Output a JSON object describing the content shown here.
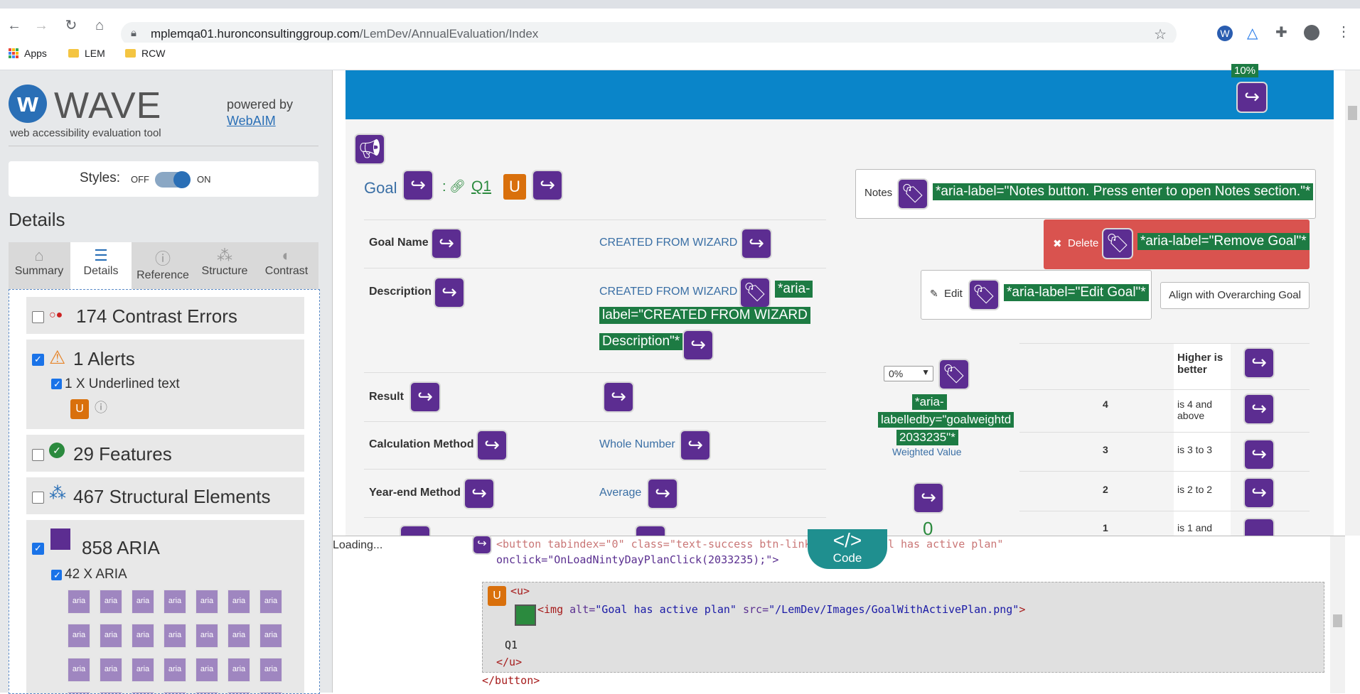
{
  "browser": {
    "url_host": "mplemqa01.huronconsultinggroup.com",
    "url_path": "/LemDev/AnnualEvaluation/Index",
    "bookmarks": [
      "Apps",
      "LEM",
      "RCW"
    ]
  },
  "wave": {
    "logo": "WAVE",
    "subtitle": "web accessibility evaluation tool",
    "powered_by": "powered by",
    "webaim": "WebAIM",
    "styles_label": "Styles:",
    "styles_off": "OFF",
    "styles_on": "ON",
    "details_heading": "Details",
    "tabs": [
      {
        "label": "Summary",
        "icon": "home-icon"
      },
      {
        "label": "Details",
        "icon": "list-icon"
      },
      {
        "label": "Reference",
        "icon": "info-icon"
      },
      {
        "label": "Structure",
        "icon": "structure-icon"
      },
      {
        "label": "Contrast",
        "icon": "contrast-icon"
      }
    ],
    "categories": {
      "contrast": "174 Contrast Errors",
      "alerts": "1 Alerts",
      "alerts_sub": "1 X Underlined text",
      "features": "29 Features",
      "structural": "467 Structural Elements",
      "aria": "858 ARIA",
      "aria_sub": "42 X ARIA"
    },
    "aria_icon_label": "aria"
  },
  "page": {
    "top_badge": "10%",
    "goal_label": "Goal",
    "goal_sep": ":",
    "goal_link": "Q1",
    "rows": [
      {
        "label": "Goal Name",
        "value": "CREATED FROM WIZARD"
      },
      {
        "label": "Description",
        "value": "CREATED FROM WIZARD"
      },
      {
        "label": "Result",
        "value": ""
      },
      {
        "label": "Calculation Method",
        "value": "Whole Number"
      },
      {
        "label": "Year-end Method",
        "value": "Average"
      }
    ],
    "desc_aria_line1": "*aria-",
    "desc_aria_line2": "label=\"CREATED FROM WIZARD",
    "desc_aria_line3": "Description\"*",
    "notes_label": "Notes",
    "notes_aria": "*aria-label=\"Notes button. Press enter to open Notes section.\"*",
    "delete_label": "Delete",
    "delete_aria": "*aria-label=\"Remove Goal\"*",
    "edit_label": "Edit",
    "edit_aria": "*aria-label=\"Edit Goal\"*",
    "align_label": "Align with Overarching Goal",
    "weight_select": "0%",
    "weight_aria_1": "*aria-",
    "weight_aria_2": "labelledby=\"goalweightd",
    "weight_aria_3": "2033235\"*",
    "weighted_value": "Weighted Value",
    "zero_value": "0",
    "rating_header": "Higher is better",
    "ratings": [
      {
        "num": "4",
        "desc": "is 4 and above"
      },
      {
        "num": "3",
        "desc": "is 3 to 3"
      },
      {
        "num": "2",
        "desc": "is 2 to 2"
      },
      {
        "num": "1",
        "desc": "is 1 and"
      }
    ]
  },
  "code": {
    "loading": "Loading...",
    "toggle_label": "Code",
    "toggle_symbol": "</>",
    "line1": "<button tabindex=\"0\" class=\"text-success btn-link\" title=\"Goal has active plan\"",
    "line2": "onclick=\"OnLoadNintyDayPlanClick(2033235);\">",
    "line3": "<u>",
    "line4_tag": "<img",
    "line4_a1": "alt=",
    "line4_v1": "\"Goal has active plan\"",
    "line4_a2": "src=",
    "line4_v2": "\"/LemDev/Images/GoalWithActivePlan.png\"",
    "line4_end": ">",
    "line5": "Q1",
    "line6": "</u>",
    "line7": "</button>"
  }
}
